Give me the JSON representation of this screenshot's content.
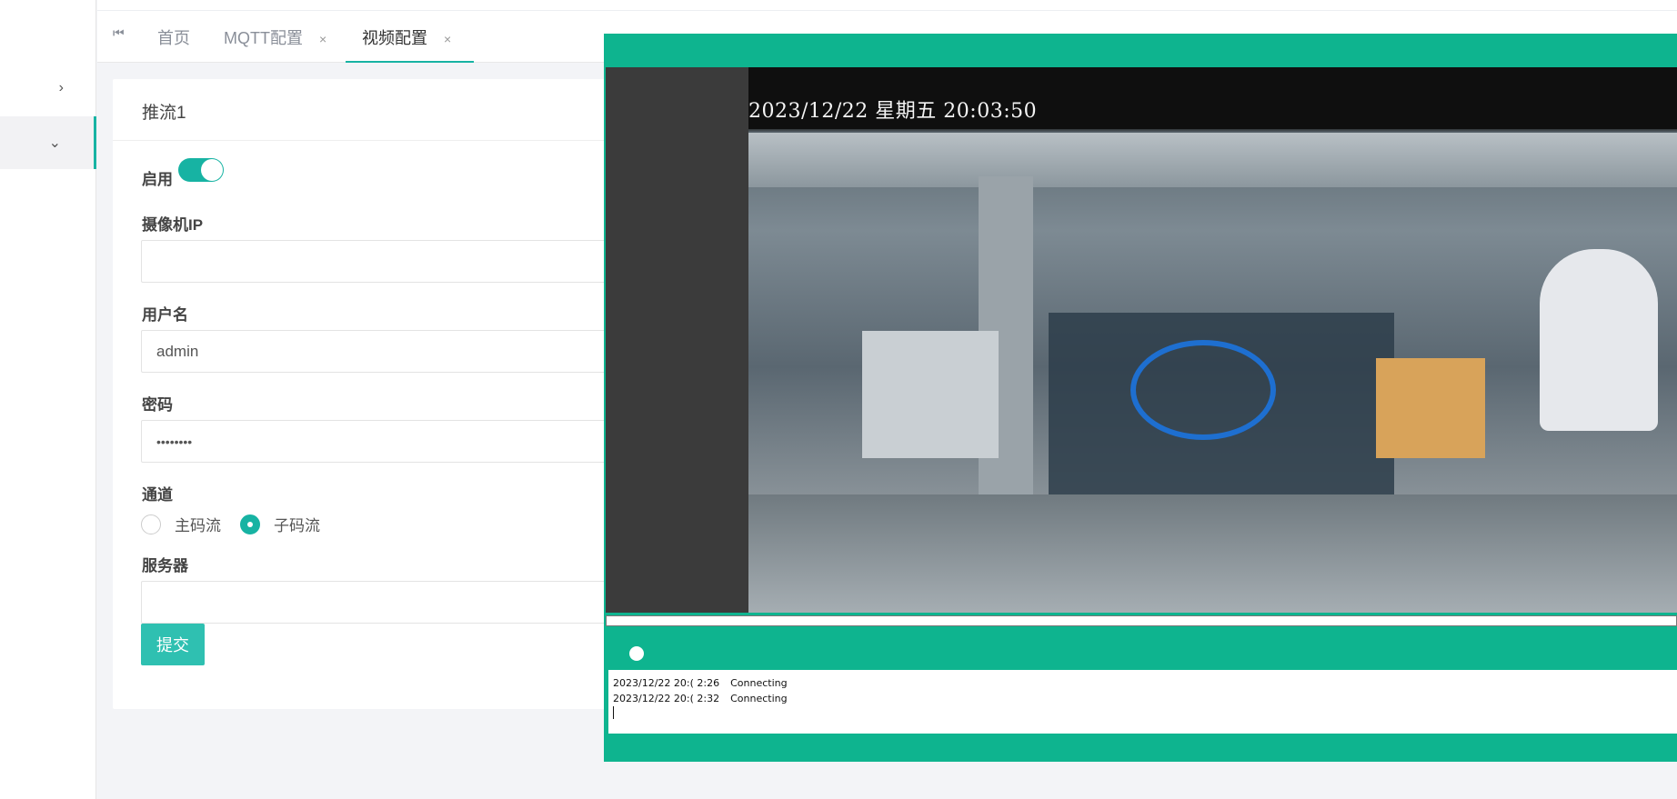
{
  "sidebar": {
    "items": [
      {
        "icon": "chevron-right-icon",
        "glyph": "›"
      },
      {
        "icon": "chevron-down-icon",
        "glyph": "⌄"
      }
    ]
  },
  "tabs": {
    "home_icon": "⏮",
    "items": [
      {
        "label": "首页"
      },
      {
        "label": "MQTT配置",
        "close": "×"
      },
      {
        "label": "视频配置",
        "close": "×"
      }
    ]
  },
  "form": {
    "title": "推流1",
    "enable_label": "启用",
    "enabled": true,
    "camera_ip_label": "摄像机IP",
    "camera_ip_value": "",
    "username_label": "用户名",
    "username_value": "admin",
    "password_label": "密码",
    "password_value": "••••••••",
    "channel_label": "通道",
    "channel_options": [
      "主码流",
      "子码流"
    ],
    "channel_selected": "子码流",
    "server_label": "服务器",
    "server_value": "",
    "submit_label": "提交"
  },
  "video": {
    "osd": "2023/12/22 星期五 20:03:50",
    "log": [
      {
        "time": "2023/12/22 20:( 2:26",
        "msg": "Connecting"
      },
      {
        "time": "2023/12/22 20:( 2:32",
        "msg": "Connecting"
      }
    ]
  },
  "colors": {
    "accent": "#17b3a3",
    "player_frame": "#0eb48f"
  }
}
